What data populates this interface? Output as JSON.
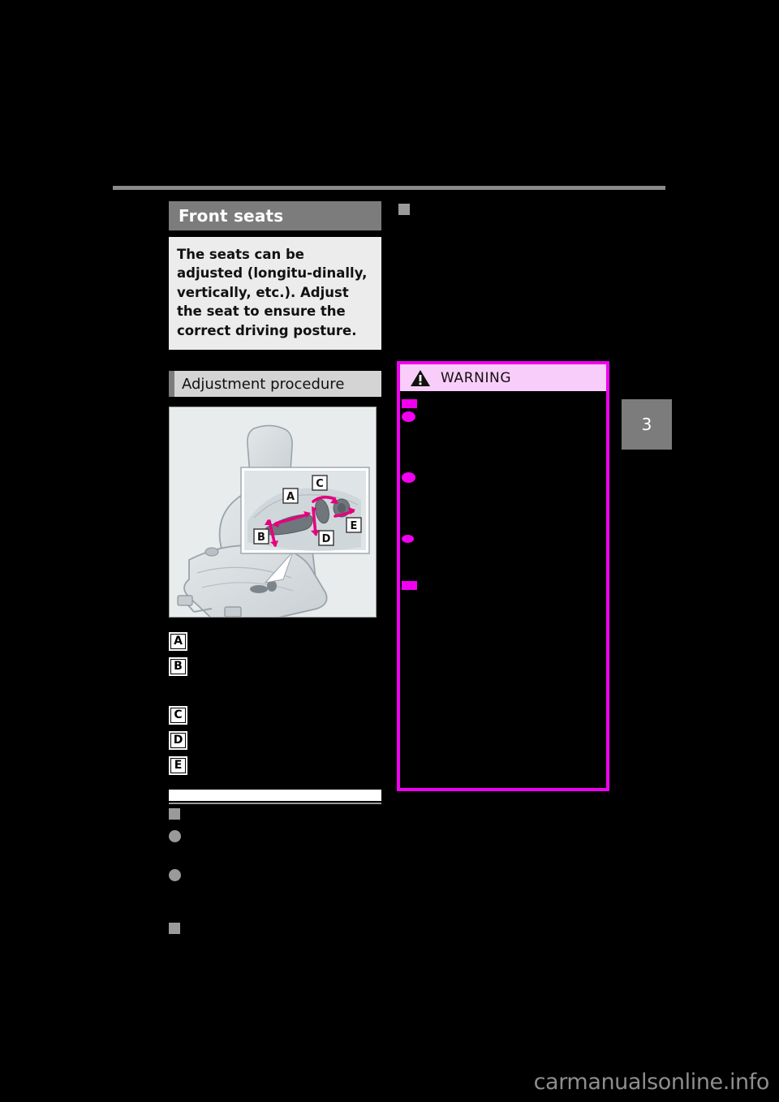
{
  "page": {
    "chapter_tab_number": "3",
    "watermark": "carmanualsonline.info",
    "colors": {
      "section_bar": "#7c7c7c",
      "subsection_bar": "#d4d4d4",
      "intro_box": "#ececec",
      "warning_border": "#f000f0",
      "warning_header": "#f9cdf9",
      "bullet_gray": "#9a9a9a",
      "rule_gray": "#8a8a8a",
      "figure_bg": "#e8ecec"
    }
  },
  "left_column": {
    "section_title": "Front seats",
    "intro_paragraph": "The seats can be adjusted (longitu-dinally, vertically, etc.). Adjust the seat to ensure the correct driving posture.",
    "subsection_title": "Adjustment procedure",
    "figure": {
      "name": "front-seat-adjustment-switches",
      "callout_labels": [
        "A",
        "B",
        "C",
        "D",
        "E"
      ]
    },
    "items": [
      {
        "badge": "A",
        "text": ""
      },
      {
        "badge": "B",
        "text": ""
      },
      {
        "badge": "C",
        "text": ""
      },
      {
        "badge": "D",
        "text": ""
      },
      {
        "badge": "E",
        "text": ""
      }
    ],
    "notes_heading": "",
    "notes": [
      {
        "marker": "square",
        "text": ""
      },
      {
        "marker": "dot",
        "text": ""
      },
      {
        "marker": "dot",
        "text": ""
      },
      {
        "marker": "square",
        "text": ""
      }
    ]
  },
  "right_column": {
    "lead_marker": "square",
    "lead_text": "",
    "warning": {
      "title": "WARNING",
      "icon": "warning-triangle-icon",
      "items": [
        {
          "marker": "square",
          "text": ""
        },
        {
          "marker": "dot",
          "text": ""
        },
        {
          "marker": "dot",
          "text": ""
        },
        {
          "marker": "dot",
          "text": ""
        },
        {
          "marker": "square",
          "text": ""
        }
      ]
    }
  }
}
